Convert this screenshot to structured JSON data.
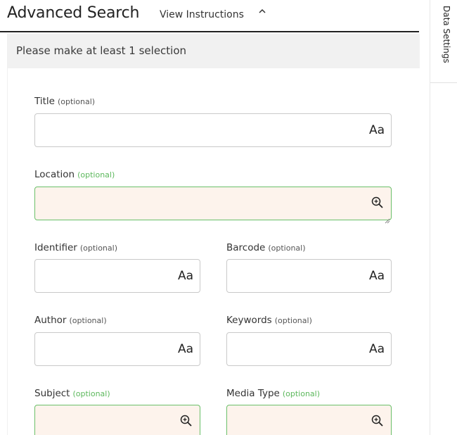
{
  "header": {
    "title": "Advanced Search",
    "instructions_link": "View Instructions",
    "chevron": "^"
  },
  "notice": "Please make at least 1 selection",
  "fields": {
    "title": {
      "label": "Title",
      "optional": "(optional)",
      "icon": "Aa",
      "value": ""
    },
    "location": {
      "label": "Location",
      "optional": "(optional)",
      "icon": "zoom-in-icon",
      "value": ""
    },
    "identifier": {
      "label": "Identifier",
      "optional": "(optional)",
      "icon": "Aa",
      "value": ""
    },
    "barcode": {
      "label": "Barcode",
      "optional": "(optional)",
      "icon": "Aa",
      "value": ""
    },
    "author": {
      "label": "Author",
      "optional": "(optional)",
      "icon": "Aa",
      "value": ""
    },
    "keywords": {
      "label": "Keywords",
      "optional": "(optional)",
      "icon": "Aa",
      "value": ""
    },
    "subject": {
      "label": "Subject",
      "optional": "(optional)",
      "icon": "zoom-in-icon",
      "value": ""
    },
    "media_type": {
      "label": "Media Type",
      "optional": "(optional)",
      "icon": "zoom-in-icon",
      "value": ""
    }
  },
  "side_tab": "Data Settings",
  "colors": {
    "lookup_bg": "#fdf3ec",
    "lookup_border": "#6abf69",
    "optional_green": "#5cb85c",
    "header_rule": "#222222"
  }
}
